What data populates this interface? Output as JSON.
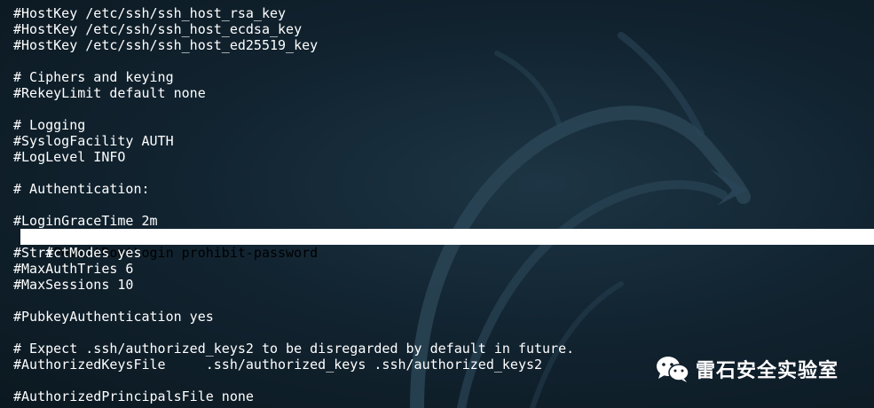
{
  "terminal": {
    "lines": [
      "#HostKey /etc/ssh/ssh_host_rsa_key",
      "#HostKey /etc/ssh/ssh_host_ecdsa_key",
      "#HostKey /etc/ssh/ssh_host_ed25519_key",
      "",
      "# Ciphers and keying",
      "#RekeyLimit default none",
      "",
      "# Logging",
      "#SyslogFacility AUTH",
      "#LogLevel INFO",
      "",
      "# Authentication:",
      "",
      "#LoginGraceTime 2m",
      "",
      "#StrictModes yes",
      "#MaxAuthTries 6",
      "#MaxSessions 10",
      "",
      "#PubkeyAuthentication yes",
      "",
      "# Expect .ssh/authorized_keys2 to be disregarded by default in future.",
      "#AuthorizedKeysFile     .ssh/authorized_keys .ssh/authorized_keys2",
      "",
      "#AuthorizedPrincipalsFile none"
    ],
    "selected_line": {
      "prefix": "#",
      "text": "PermitRootLogin prohibit-password"
    }
  },
  "watermark": {
    "text": "雷石安全实验室",
    "icon": "wechat-icon"
  },
  "colors": {
    "text": "#ffffff",
    "selection_bg": "#ffffff",
    "selection_text": "#000000",
    "background": "#122431"
  }
}
